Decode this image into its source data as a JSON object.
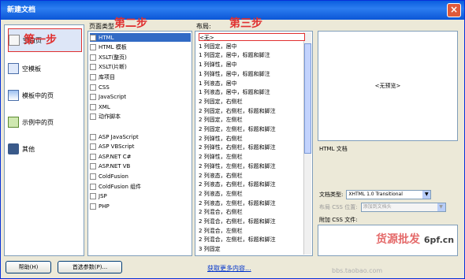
{
  "window": {
    "title": "新建文档",
    "close": "×"
  },
  "categories": {
    "items": [
      {
        "label": "空白页",
        "icon": "blank-page-icon"
      },
      {
        "label": "空模板",
        "icon": "blank-template-icon"
      },
      {
        "label": "模板中的页",
        "icon": "template-page-icon"
      },
      {
        "label": "示例中的页",
        "icon": "sample-page-icon"
      },
      {
        "label": "其他",
        "icon": "other-icon"
      }
    ]
  },
  "annotations": {
    "step1": "第一步",
    "step2": "第二步",
    "step3": "第三步"
  },
  "page_type": {
    "label": "页面类型",
    "items": [
      "HTML",
      "HTML 模板",
      "XSLT(整页)",
      "XSLT(片断)",
      "库项目",
      "CSS",
      "JavaScript",
      "XML",
      "动作脚本",
      "",
      "ASP JavaScript",
      "ASP VBScript",
      "ASP.NET C#",
      "ASP.NET VB",
      "ColdFusion",
      "ColdFusion 组件",
      "JSP",
      "PHP"
    ]
  },
  "layout": {
    "label": "布局:",
    "items": [
      "<无>",
      "1 列固定，居中",
      "1 列固定，居中，标题和脚注",
      "1 列弹性，居中",
      "1 列弹性，居中，标题和脚注",
      "1 列液态，居中",
      "1 列液态，居中，标题和脚注",
      "2 列固定，右侧栏",
      "2 列固定，右侧栏，标题和脚注",
      "2 列固定，左侧栏",
      "2 列固定，左侧栏，标题和脚注",
      "2 列弹性，右侧栏",
      "2 列弹性，右侧栏，标题和脚注",
      "2 列弹性，左侧栏",
      "2 列弹性，左侧栏，标题和脚注",
      "2 列液态，右侧栏",
      "2 列液态，右侧栏，标题和脚注",
      "2 列液态，左侧栏",
      "2 列液态，左侧栏，标题和脚注",
      "2 列混合，右侧栏",
      "2 列混合，右侧栏，标题和脚注",
      "2 列混合，左侧栏",
      "2 列混合，左侧栏，标题和脚注",
      "3 列固定"
    ]
  },
  "preview": {
    "text": "<无预览>",
    "description": "HTML 文档"
  },
  "form": {
    "doctype_label": "文档类型:",
    "doctype_value": "XHTML 1.0 Transitional",
    "layout_css_label": "布局 CSS 位置:",
    "layout_css_value": "添加到文档头",
    "attach_css_label": "附加 CSS 文件:"
  },
  "buttons": {
    "help": "帮助(H)",
    "prefs": "首选参数(P)...",
    "more": "获取更多内容..."
  },
  "watermark": {
    "brand": "货源批发",
    "site": "6pf.cn",
    "url": "bbs.taobao.com"
  }
}
